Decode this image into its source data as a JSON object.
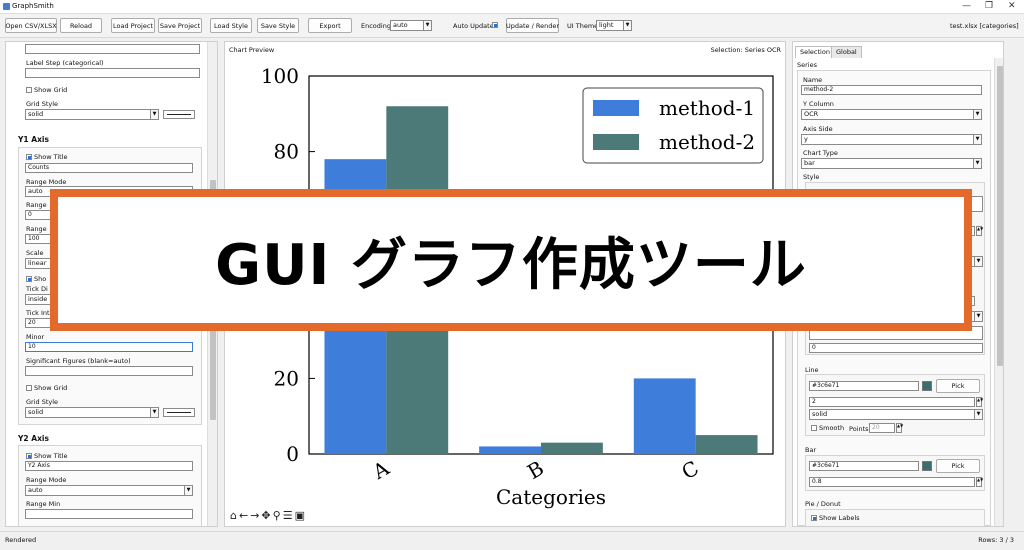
{
  "window": {
    "title": "GraphSmith"
  },
  "toolbar": {
    "open": "Open CSV/XLSX",
    "reload": "Reload",
    "load_project": "Load Project",
    "save_project": "Save Project",
    "load_style": "Load Style",
    "save_style": "Save Style",
    "export": "Export",
    "encoding_label": "Encoding",
    "encoding_value": "auto",
    "auto_update_label": "Auto Update",
    "update_render": "Update / Render",
    "ui_theme_label": "UI Theme",
    "ui_theme_value": "light",
    "file_info": "test.xlsx [categories]"
  },
  "left": {
    "x_section": {
      "label_step": "Label Step (categorical)",
      "show_grid": "Show Grid",
      "grid_style_label": "Grid Style",
      "grid_style": "solid"
    },
    "y1": {
      "header": "Y1 Axis",
      "show_title": "Show Title",
      "title_value": "Counts",
      "range_mode_label": "Range Mode",
      "range_mode": "auto",
      "range_min_label": "Range",
      "range_min": "0",
      "range_max_label": "Range",
      "range_max": "100",
      "scale_label": "Scale",
      "scale": "linear",
      "show_label": "Sho",
      "tick_dir_label": "Tick Di",
      "tick_dir": "inside",
      "tick_int_label": "Tick Int",
      "tick_int": "20",
      "minor_label": "Minor",
      "minor": "10",
      "sig_label": "Significant Figures (blank=auto)",
      "show_grid": "Show Grid",
      "grid_style_label": "Grid Style",
      "grid_style": "solid"
    },
    "y2": {
      "header": "Y2 Axis",
      "show_title": "Show Title",
      "title_value": "Y2 Axis",
      "range_mode_label": "Range Mode",
      "range_mode": "auto",
      "range_min_label": "Range Min"
    }
  },
  "center": {
    "panel_title": "Chart Preview",
    "selection": "Selection: Series OCR"
  },
  "overlay": {
    "text": "GUI グラフ作成ツール"
  },
  "chart_data": {
    "type": "bar",
    "categories": [
      "A",
      "B",
      "C"
    ],
    "series": [
      {
        "name": "method-1",
        "values": [
          78,
          2,
          20
        ],
        "color": "#3f7ddb"
      },
      {
        "name": "method-2",
        "values": [
          92,
          3,
          5
        ],
        "color": "#4b7a79"
      }
    ],
    "xlabel": "Categories",
    "ylabel": "",
    "ylim": [
      0,
      100
    ],
    "yticks": [
      0,
      20,
      80,
      100
    ],
    "legend": "top-right",
    "grid": false
  },
  "right": {
    "tabs": [
      "Selection",
      "Global"
    ],
    "series_label": "Series",
    "name_label": "Name",
    "name": "method-2",
    "ycol_label": "Y Column",
    "ycol": "OCR",
    "axis_side_label": "Axis Side",
    "axis_side": "y",
    "chart_type_label": "Chart Type",
    "chart_type": "bar",
    "style_label": "Style",
    "zero_value": "0",
    "line_label": "Line",
    "line_color": "#3c6e71",
    "pick": "Pick",
    "line_width": "2",
    "line_style": "solid",
    "smooth": "Smooth",
    "points_label": "Points",
    "points": "20",
    "bar_label": "Bar",
    "bar_color": "#3c6e71",
    "bar_width": "0.8",
    "pie_label": "Pie / Donut",
    "show_labels": "Show Labels"
  },
  "status": {
    "left": "Rendered",
    "right": "Rows: 3 / 3"
  }
}
